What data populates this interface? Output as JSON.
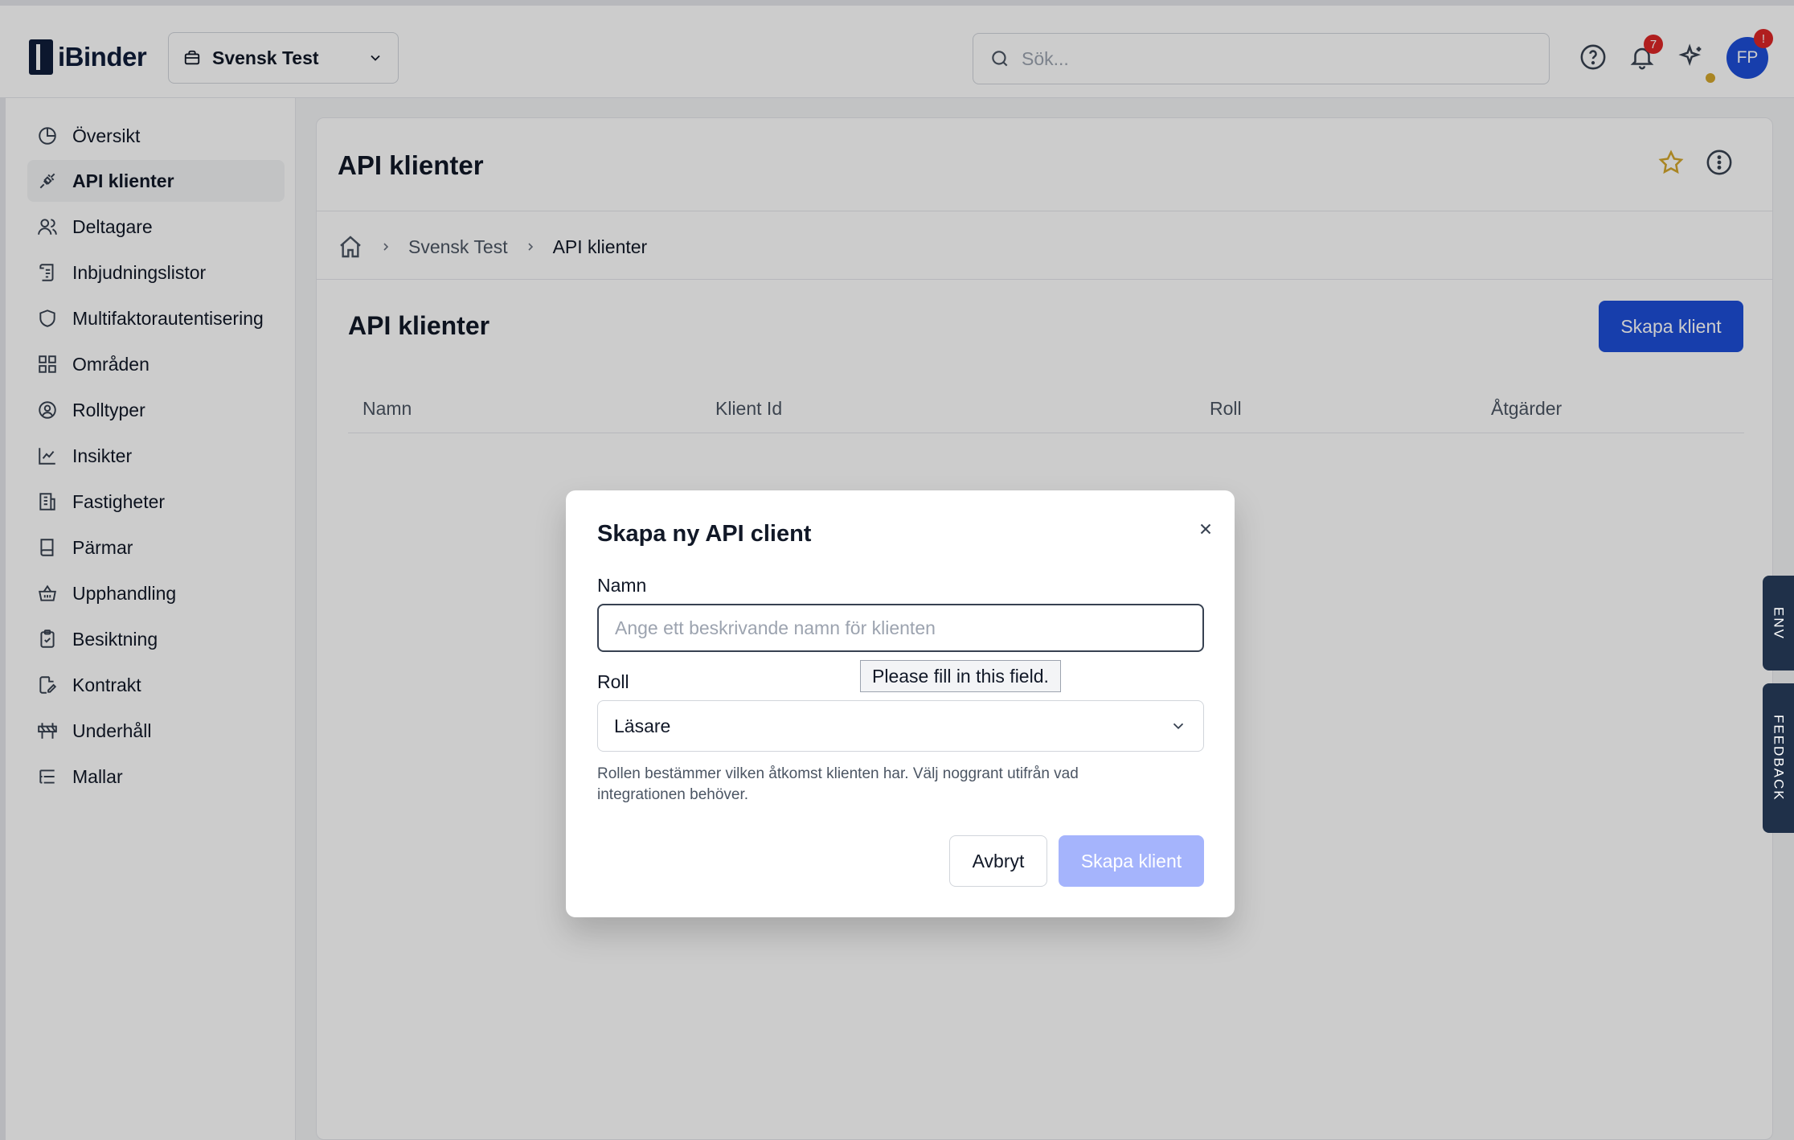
{
  "app": {
    "logo_text": "iBinder"
  },
  "header": {
    "workspace": "Svensk Test",
    "search": {
      "placeholder": "Sök...",
      "value": ""
    },
    "notifications_count": "7",
    "avatar_initials": "FP",
    "avatar_badge": "!"
  },
  "sidebar": {
    "items": [
      {
        "label": "Översikt",
        "icon": "pie-chart-icon"
      },
      {
        "label": "API klienter",
        "icon": "plug-icon",
        "active": true
      },
      {
        "label": "Deltagare",
        "icon": "users-icon"
      },
      {
        "label": "Inbjudningslistor",
        "icon": "scroll-list-icon"
      },
      {
        "label": "Multifaktorautentisering",
        "icon": "shield-icon"
      },
      {
        "label": "Områden",
        "icon": "grid-icon"
      },
      {
        "label": "Rolltyper",
        "icon": "user-circle-icon"
      },
      {
        "label": "Insikter",
        "icon": "line-chart-icon"
      },
      {
        "label": "Fastigheter",
        "icon": "building-icon"
      },
      {
        "label": "Pärmar",
        "icon": "book-icon"
      },
      {
        "label": "Upphandling",
        "icon": "basket-icon"
      },
      {
        "label": "Besiktning",
        "icon": "clipboard-check-icon"
      },
      {
        "label": "Kontrakt",
        "icon": "file-edit-icon"
      },
      {
        "label": "Underhåll",
        "icon": "barrier-icon"
      },
      {
        "label": "Mallar",
        "icon": "list-tree-icon"
      }
    ]
  },
  "page": {
    "title": "API klienter",
    "breadcrumb": [
      "Svensk Test",
      "API klienter"
    ],
    "section_title": "API klienter",
    "create_button": "Skapa klient",
    "table_headers": [
      "Namn",
      "Klient Id",
      "Roll",
      "Åtgärder"
    ]
  },
  "side_tabs": {
    "env": "ENV",
    "feedback": "FEEDBACK"
  },
  "modal": {
    "title": "Skapa ny API client",
    "name_label": "Namn",
    "name_placeholder": "Ange ett beskrivande namn för klienten",
    "name_value": "",
    "validation_tooltip": "Please fill in this field.",
    "role_label": "Roll",
    "role_value": "Läsare",
    "role_help": "Rollen bestämmer vilken åtkomst klienten har. Välj noggrant utifrån vad integrationen behöver.",
    "cancel_label": "Avbryt",
    "submit_label": "Skapa klient"
  },
  "colors": {
    "primary": "#1d4ed8",
    "primary_disabled": "#a5b4fc",
    "star": "#d4a72c",
    "badge": "#dc2626",
    "navy": "#1f3049"
  }
}
